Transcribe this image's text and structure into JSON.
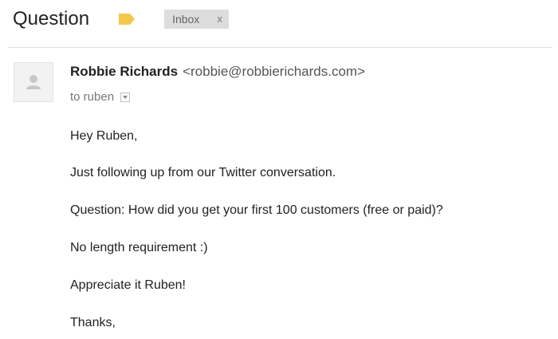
{
  "header": {
    "subject": "Question",
    "label_icon": "label-tag-icon",
    "label_color": "#f4c84a",
    "chip": {
      "label": "Inbox",
      "remove": "x"
    }
  },
  "message": {
    "avatar_icon": "person-icon",
    "sender_name": "Robbie Richards",
    "sender_email": "<robbie@robbierichards.com>",
    "to": "to ruben",
    "details_icon": "chevron-down-icon",
    "body": [
      "Hey Ruben,",
      "Just following up from our Twitter conversation.",
      "Question: How did you get your first 100 customers (free or paid)?",
      "No length requirement :)",
      "Appreciate it Ruben!",
      "Thanks,"
    ]
  }
}
